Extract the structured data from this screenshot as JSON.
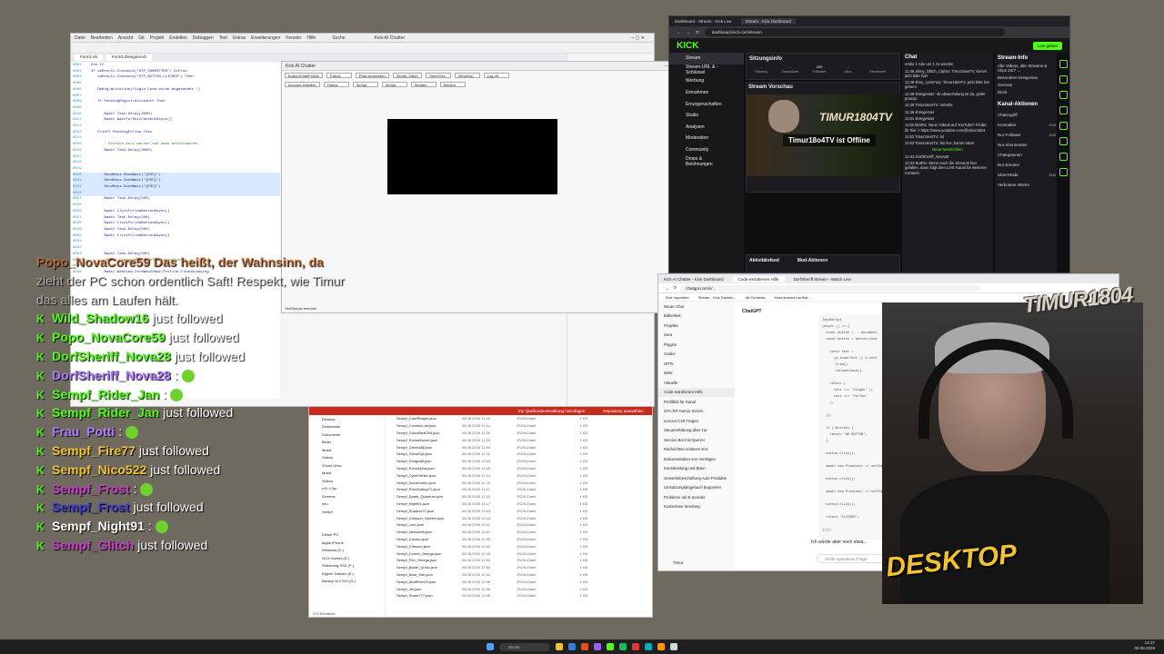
{
  "vs": {
    "menu": [
      "Datei",
      "Bearbeiten",
      "Ansicht",
      "Git",
      "Projekt",
      "Erstellen",
      "Debuggen",
      "Test",
      "Extras",
      "Erweiterungen",
      "Fenster",
      "Hilfe"
    ],
    "search": "Suche",
    "title": "Kick-AI Chatter",
    "tabs": [
      "Form1.vb",
      "Form1.Designer.vb"
    ],
    "code": [
      {
        "n": "6002",
        "t": "End If"
      },
      {
        "n": "6003",
        "t": "If obResult.Contains(\"OTP_SUBMITTED\") OrElse"
      },
      {
        "n": "6004",
        "t": "   obResult.Contains(\"OTP_BUTTON_CLICKED\") Then"
      },
      {
        "n": "6005",
        "t": ""
      },
      {
        "n": "6006",
        "t": "   Debug.WriteLine(\"Login Code wurde abgesendet.\")"
      },
      {
        "n": "6007",
        "t": ""
      },
      {
        "n": "6008",
        "t": "   If PendingRegistrationAuth Then"
      },
      {
        "n": "6009",
        "t": ""
      },
      {
        "n": "6010",
        "t": "      Await Task.Delay(3000)"
      },
      {
        "n": "6011",
        "t": "      Await WaitForSkitConsentAsync()"
      },
      {
        "n": "6012",
        "t": ""
      },
      {
        "n": "6013",
        "t": "   ElseIf PendingFollow Then"
      },
      {
        "n": "6014",
        "t": ""
      },
      {
        "n": "6015",
        "t": "      ' Einfach kurz warten und dann weitermachen"
      },
      {
        "n": "6016",
        "t": "      Await Task.Delay(3000)"
      },
      {
        "n": "6017",
        "t": ""
      },
      {
        "n": "6018",
        "t": ""
      },
      {
        "n": "6019",
        "t": ""
      },
      {
        "n": "6020",
        "t": "      SendKeys.SendWait(\"{ESC}\")"
      },
      {
        "n": "6021",
        "t": "      SendKeys.SendWait(\"{ESC}\")"
      },
      {
        "n": "6022",
        "t": "      SendKeys.SendWait(\"{ESC}\")"
      },
      {
        "n": "6023",
        "t": ""
      },
      {
        "n": "6024",
        "t": "      Await Task.Delay(500)"
      },
      {
        "n": "6025",
        "t": ""
      },
      {
        "n": "6026",
        "t": "      Await ClickFollowButtonAsync()"
      },
      {
        "n": "6027",
        "t": "      Await Task.Delay(500)"
      },
      {
        "n": "6028",
        "t": "      Await ClickFollowButtonAsync()"
      },
      {
        "n": "6029",
        "t": "      Await Task.Delay(500)"
      },
      {
        "n": "6030",
        "t": "      Await ClickFollowButtonAsync()"
      },
      {
        "n": "6031",
        "t": ""
      },
      {
        "n": "6032",
        "t": ""
      },
      {
        "n": "6033",
        "t": "      Await Task.Delay(500)"
      },
      {
        "n": "6034",
        "t": "      'Await ContinueFollowAfterLoginAsync()"
      },
      {
        "n": "6035",
        "t": ""
      },
      {
        "n": "6036",
        "t": "      Await WebView.CoreWebView2.Profile.ClearBrowsing"
      }
    ]
  },
  "kickChatter": {
    "title": "Kick AI Chatter",
    "row1": [
      "Button/Chat/Follow",
      "Follow",
      "Pfad verwenden",
      "Sempf_Glitch",
      "Timer/Sec",
      "Viewer(s)",
      "Log off"
    ],
    "row2": [
      "Account erstellen",
      "Follow",
      "Sempf_",
      "Sempf",
      "Senden",
      "Monitor"
    ],
    "status": "TestSkripts beendet"
  },
  "kick": {
    "tabs": [
      "Dashboard - Stream - Kick Live",
      "Stream - Kick Dashboard"
    ],
    "url": "dashboard.kick.com/stream",
    "logo": "KICK",
    "live_button": "Live gehen",
    "nav": [
      "Stream",
      "Stream-URL & -Schlüssel",
      "Werbung",
      "Einnahmen",
      "Errungenschaften",
      "Studio",
      "Analysen",
      "Moderation",
      "Community",
      "Drops & Belohnungen"
    ],
    "beta": "Beta",
    "session_title": "Sitzungsinfo",
    "session_status": "OFFLINE",
    "session_stats": [
      {
        "v": "-",
        "l": "Sitzung"
      },
      {
        "v": "-",
        "l": "Zuschauer"
      },
      {
        "v": "209",
        "l": "Follower"
      },
      {
        "v": "-",
        "l": "Abo-"
      },
      {
        "v": "-",
        "l": "Sendezeit"
      }
    ],
    "preview_title": "Stream Vorschau",
    "offline_text": "Timur18o4TV ist Offline",
    "offline_badge": "OFFLINE",
    "brand": "TIMUR1804TV",
    "activity_title": "Aktivitätsfeed",
    "activity_item": "Timur18o4",
    "activity_sub": "folgt jetzt dem Kanal",
    "activity_time": "vor 3 Stunden",
    "mod_title": "Mod-Aktionen",
    "chat_title": "Chat",
    "chat_lines": [
      "renke 1 Abo um 1 zu werden",
      "11:48 ahmy_Glitch_Cipher: Timur18o4TV, komm jetzt bitte live!",
      "11:48 shny_LynxFury: Timur18o4TV, jetzt bitte live gehen!",
      "11:48 shmyjesser: ok abwechslung ist da, geiler prompt",
      "11:49 Timur18o4TV: hehehe",
      "11:49 shmyjesser",
      "11:51 shmyjesser",
      "11:52 BotRix: Neue Videos auf YouTube? Findet ihr hier > https://www.youtube.com/@timur1804",
      "11:52 Timur18o4TV: lol",
      "11:53 Timur18o4TV: bin live, komm rüber",
      "Neue Nachrichten",
      "12:43 DorfSheriff_Nova28",
      "12:43 BotRix: Wenn euch die Streams hier gefallen, dann folgt dem LIVE Kanal für weiteren Content!"
    ],
    "stream_info_title": "Stream-Info",
    "stream_info": [
      "Alle Videos, alle Streams & Clips 24/7 ...",
      "Besondere Ereignisse",
      "German",
      "Nicht"
    ],
    "channel_actions_title": "Kanal-Aktionen",
    "channel_actions": [
      {
        "l": "Chatzugriff",
        "v": ""
      },
      {
        "l": "Kontoalter",
        "v": "Aus"
      },
      {
        "l": "Nur Follower",
        "v": "Aus"
      },
      {
        "l": "Nur Abonnenten",
        "v": ""
      },
      {
        "l": "Chatoptionen",
        "v": ""
      },
      {
        "l": "Nur Emotes",
        "v": ""
      },
      {
        "l": "Slow-Mode",
        "v": "Aus"
      },
      {
        "l": "Verbotene Wörter",
        "v": ""
      }
    ]
  },
  "explorer": {
    "banner": [
      "Zur Quellcodeverwaltung hinzufügen",
      "Repository auswählen"
    ],
    "nav": [
      "Desktop",
      "Downloads",
      "Dokumente",
      "Bilder",
      "Musik",
      "Videos",
      "iCloud Drive",
      "Musik",
      "Videos",
      "z.B. LSpr",
      "Screens",
      "neu",
      "Sempf",
      "",
      "",
      "Dieser PC",
      "Apple iPhone",
      "Windows (C:)",
      "OLD Games (D:)",
      "Streaming SSD (F:)",
      "Eigene Dateien (E:)",
      "Backup M.2 NVI (G:)"
    ],
    "files": [
      {
        "n": "Sempf_CoreReaper.json",
        "d": "08.08.2026 11:45",
        "t": "JSON-Datei",
        "s": "1 KB"
      },
      {
        "n": "Sempf_CosmicLoaf.json",
        "d": "08.08.2026 11:44",
        "t": "JSON-Datei",
        "s": "1 KB"
      },
      {
        "n": "Sempf_CitrusBeat294.json",
        "d": "08.08.2026 12:20",
        "t": "JSON-Datei",
        "s": "1 KB"
      },
      {
        "n": "Sempf_RocketNovel.json",
        "d": "08.08.2026 12:23",
        "t": "JSON-Datei",
        "s": "1 KB"
      },
      {
        "n": "Sempf_Gemini88.json",
        "d": "08.08.2026 12:09",
        "t": "JSON-Datei",
        "s": "1 KB"
      },
      {
        "n": "Sempf_GhostOj4.json",
        "d": "08.08.2026 12:11",
        "t": "JSON-Datei",
        "s": "1 KB"
      },
      {
        "n": "Sempf_Dodge88.json",
        "d": "08.08.2026 13:04",
        "t": "JSON-Datei",
        "s": "1 KB"
      },
      {
        "n": "Sempf_EchoAlpha.json",
        "d": "08.08.2026 11:48",
        "t": "JSON-Datei",
        "s": "1 KB"
      },
      {
        "n": "Sempf_CyberStrike.json",
        "d": "08.08.2026 12:14",
        "t": "JSON-Datei",
        "s": "1 KB"
      },
      {
        "n": "Sempf_NovaVortex.json",
        "d": "08.08.2026 12:10",
        "t": "JSON-Datei",
        "s": "1 KB"
      },
      {
        "n": "Sempf_PixelGalaxy71.json",
        "d": "08.08.2026 11:47",
        "t": "JSON-Datei",
        "s": "1 KB"
      },
      {
        "n": "Sempf_Spark_Quantum.json",
        "d": "08.08.2026 12:02",
        "t": "JSON-Datei",
        "s": "1 KB"
      },
      {
        "n": "Sempf_Night91.json",
        "d": "08.08.2026 13:17",
        "t": "JSON-Datei",
        "s": "1 KB"
      },
      {
        "n": "Sempf_Shadow77.json",
        "d": "08.08.2026 13:03",
        "t": "JSON-Datei",
        "s": "1 KB"
      },
      {
        "n": "Sempf_Crimson_Stream.json",
        "d": "08.08.2026 13:44",
        "t": "JSON-Datei",
        "s": "1 KB"
      },
      {
        "n": "Sempf_Lunr.json",
        "d": "08.08.2026 13:01",
        "t": "JSON-Datei",
        "s": "1 KB"
      },
      {
        "n": "Sempf_Nebula99.json",
        "d": "08.08.2026 12:47",
        "t": "JSON-Datei",
        "s": "1 KB"
      },
      {
        "n": "Sempf_Cosmo.json",
        "d": "08.08.2026 12:35",
        "t": "JSON-Datei",
        "s": "1 KB"
      },
      {
        "n": "Sempf_Crimson.json",
        "d": "08.08.2026 13:02",
        "t": "JSON-Datei",
        "s": "1 KB"
      },
      {
        "n": "Sempf_Comet_Omega.json",
        "d": "08.08.2026 12:43",
        "t": "JSON-Datei",
        "s": "1 KB"
      },
      {
        "n": "Sempf_Fire_Omega.json",
        "d": "08.08.2026 12:52",
        "t": "JSON-Datei",
        "s": "1 KB"
      },
      {
        "n": "Sempf_Blade_Quick.json",
        "d": "08.08.2026 12:53",
        "t": "JSON-Datei",
        "s": "1 KB"
      },
      {
        "n": "Sempf_Bear_Kite.json",
        "d": "08.08.2026 12:32",
        "t": "JSON-Datei",
        "s": "1 KB"
      },
      {
        "n": "Sempf_WolfPixel23.json",
        "d": "08.08.2026 12:46",
        "t": "JSON-Datei",
        "s": "1 KB"
      },
      {
        "n": "Sempf_Jet.json",
        "d": "08.08.2026 12:56",
        "t": "JSON-Datei",
        "s": "1 KB"
      },
      {
        "n": "Sempf_Storm777.json",
        "d": "08.08.2026 13:08",
        "t": "JSON-Datei",
        "s": "1 KB"
      }
    ],
    "status": "212 Elemente"
  },
  "chatgpt": {
    "tabs": [
      "Kick AI Chatter - Kick Dashboard",
      "Code-extrahieren Hilfe",
      "DorfSheriff Stream - Watch Live"
    ],
    "url": "chatgpt.com/c/...",
    "bookmarks": [
      "Kick Importiert",
      "Stream - Kick Dashbo...",
      "All Contents",
      "Most desired me first ..."
    ],
    "brand": "ChatGPT",
    "sidebar": [
      "Neuer Chat",
      "Bibliothek",
      "Projekte",
      "Sora",
      "Plugins",
      "Codex",
      "GPTs",
      "Mehr",
      "Aktuelle",
      "Code extrahieren Hilfe",
      "Profilbild für Kanal",
      "GTA RP Humor Server",
      "Lenovo C30 Fragen",
      "Steuererklärung über zur",
      "Service Bot mit OpenAI",
      "Nachrichten imitieren KIV",
      "Dokumentation von Verträgen",
      "Kontoleistung und Bann",
      "Gewerbebeschaftung Auto Produkte",
      "Umsatzungsbogebuch begonnen",
      "Probleme mit E-Scooter",
      "Kostenlose Sendung"
    ],
    "code": [
      "JavaScript",
      "(async () => {",
      "  const button = ...document",
      "  const button = button.find",
      "",
      "    const text =",
      "      (b.innerText || b.text",
      "      .trim()",
      "      .toLowerCase()",
      "",
      "    return (",
      "      text === 'folgen' ||",
      "      text === 'follow'",
      "    );",
      "",
      "  });",
      "",
      "  if (!button) {",
      "    return 'NO BUTTON';",
      "  }",
      "",
      "  button.click();",
      "",
      "  await new Promise(r => setTim",
      "",
      "  button.click();",
      "",
      "  await new Promise(r => setTim",
      "",
      "  button.click();",
      "",
      "  return 'CLICKED';",
      "",
      "})();"
    ],
    "prompt": "Ich würde aber noch etwa...",
    "input_placeholder": "Stelle irgendeine Frage",
    "user": "Timur"
  },
  "webcam": {
    "logo_top": "TIMUR1804",
    "logo_bottom": "DESKTOP"
  },
  "overlay": {
    "partial1": "Popo_NovaCore59 Das heißt, der Wahnsinn, da",
    "partial2": "zieht der PC schon ordentlich Saft! Respekt, wie Timur",
    "partial3": "das alles am Laufen hält.",
    "lines": [
      {
        "user": "Wild_Shadow16",
        "text": "just followed",
        "color": "#53fc18",
        "emote": false
      },
      {
        "user": "Popo_NovaCore59",
        "text": "just followed",
        "color": "#53fc18",
        "emote": false
      },
      {
        "user": "DorfSheriff_Nova28",
        "text": "just followed",
        "color": "#53fc18",
        "emote": false
      },
      {
        "user": "DorfSheriff_Nova28",
        "text": ":",
        "color": "#b07cff",
        "emote": true
      },
      {
        "user": "Sempf_Rider_Jan",
        "text": ":",
        "color": "#53fc18",
        "emote": true
      },
      {
        "user": "Sempf_Rider_Jan",
        "text": "just followed",
        "color": "#53fc18",
        "emote": false
      },
      {
        "user": "Frau_Potti",
        "text": ":",
        "color": "#b07cff",
        "emote": true
      },
      {
        "user": "Sempf_Fire77",
        "text": "just followed",
        "color": "#f2c331",
        "emote": false
      },
      {
        "user": "Sempf_Nico522",
        "text": "just followed",
        "color": "#f2c331",
        "emote": false
      },
      {
        "user": "Sempf_Frost",
        "text": ":",
        "color": "#c73fc7",
        "emote": true
      },
      {
        "user": "Sempf_Frost",
        "text": "just followed",
        "color": "#3b3bd6",
        "emote": false
      },
      {
        "user": "Sempf_Night91",
        "text": ":",
        "color": "#ffffff",
        "emote": true
      },
      {
        "user": "Sempf_Glitch",
        "text": "just followed",
        "color": "#c73fc7",
        "emote": false
      }
    ]
  },
  "taskbar": {
    "search": "Suche",
    "time": "14:27",
    "date": "08.08.2026"
  }
}
